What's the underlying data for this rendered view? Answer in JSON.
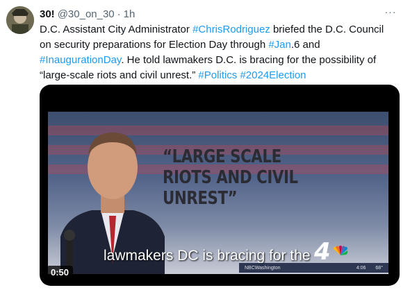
{
  "tweet": {
    "author_name": "30!",
    "handle": "@30_on_30",
    "separator": "·",
    "time": "1h",
    "more_label": "···",
    "text_lines": [
      [
        {
          "t": "D.C. Assistant City Administrator ",
          "tag": false
        },
        {
          "t": "#ChrisRodriguez",
          "tag": true
        },
        {
          "t": " briefed the D.C. Council",
          "tag": false
        }
      ],
      [
        {
          "t": "on security preparations for Election Day through ",
          "tag": false
        },
        {
          "t": "#Jan",
          "tag": true
        },
        {
          "t": ".6 and",
          "tag": false
        }
      ],
      [
        {
          "t": "#InaugurationDay",
          "tag": true
        },
        {
          "t": ". He told lawmakers D.C. is bracing for the possibility of",
          "tag": false
        }
      ],
      [
        {
          "t": "“large-scale riots and civil unrest.” ",
          "tag": false
        },
        {
          "t": "#Politics",
          "tag": true
        },
        {
          "t": " ",
          "tag": false
        },
        {
          "t": "#2024Election",
          "tag": true
        }
      ]
    ]
  },
  "video": {
    "quote_text": "“LARGE SCALE RIOTS AND CIVIL UNREST”",
    "caption": "lawmakers DC is bracing for the",
    "station_number": "4",
    "station_name": "NBCWashington",
    "clock": "4:06",
    "temperature": "68°",
    "duration": "0:50"
  },
  "colors": {
    "link": "#1d9bf0",
    "text": "#0f1419",
    "secondary": "#536471"
  }
}
